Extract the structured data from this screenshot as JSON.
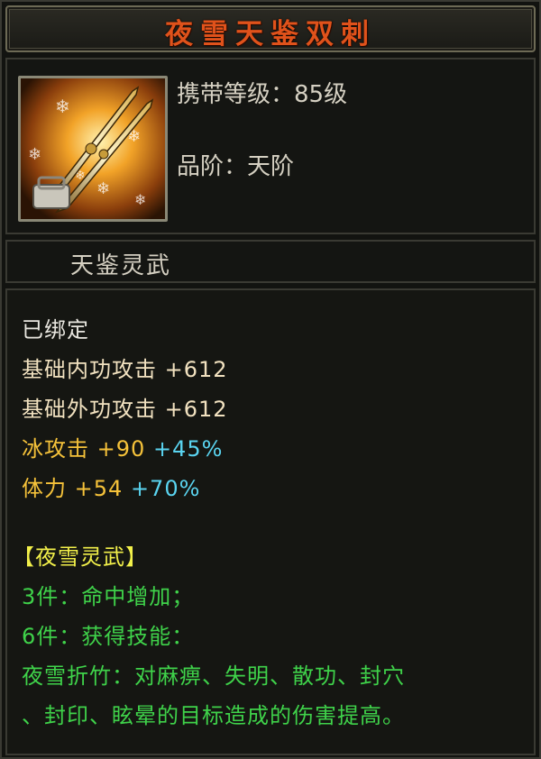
{
  "title": "夜雪天鉴双刺",
  "item": {
    "level_label": "携带等级：",
    "level_value": "85级",
    "grade_label": "品阶：",
    "grade_value": "天阶",
    "icon": "dual-dagger-icon"
  },
  "subtitle": "天鉴灵武",
  "details": {
    "bound": "已绑定",
    "stats": [
      {
        "name": "基础内功攻击",
        "value": "+612",
        "bonus": ""
      },
      {
        "name": "基础外功攻击",
        "value": "+612",
        "bonus": ""
      },
      {
        "name": "冰攻击",
        "value": "+90",
        "bonus": "+45%"
      },
      {
        "name": "体力",
        "value": "+54",
        "bonus": "+70%"
      }
    ],
    "set_name": "【夜雪灵武】",
    "set_bonuses": [
      "3件：命中增加；",
      "6件：获得技能：",
      "夜雪折竹：对麻痹、失明、散功、封穴",
      "、封印、眩晕的目标造成的伤害提高。"
    ]
  },
  "colors": {
    "title": "#e0521b",
    "stat_base": "#f2e2c0",
    "stat_element": "#f5c23a",
    "bonus_percent": "#5ad4f0",
    "set_text": "#3fd24a",
    "set_name": "#f2f04a"
  }
}
